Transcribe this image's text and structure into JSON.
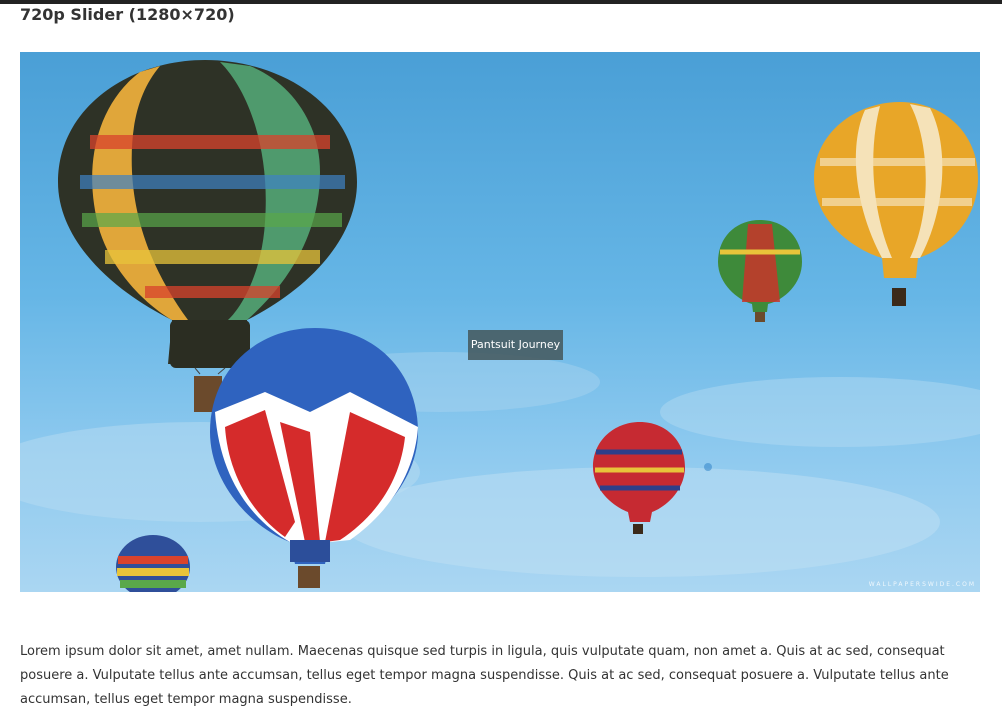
{
  "page": {
    "title": "720p Slider (1280×720)"
  },
  "slider": {
    "slide_alt": "hot air balloons in blue sky",
    "caption": "Pantsuit Journey",
    "watermark": "WALLPAPERSWIDE.COM"
  },
  "content": {
    "paragraph": "Lorem ipsum dolor sit amet, amet nullam. Maecenas quisque sed turpis in ligula, quis vulputate quam, non amet a. Quis at ac sed, consequat posuere a. Vulputate tellus ante accumsan, tellus eget tempor magna suspendisse. Quis at ac sed, consequat posuere a. Vulputate tellus ante accumsan, tellus eget tempor magna suspendisse."
  },
  "colors": {
    "sky": "#5aaee2",
    "caption_bg": "#465a5f",
    "top_bar": "#222222"
  }
}
